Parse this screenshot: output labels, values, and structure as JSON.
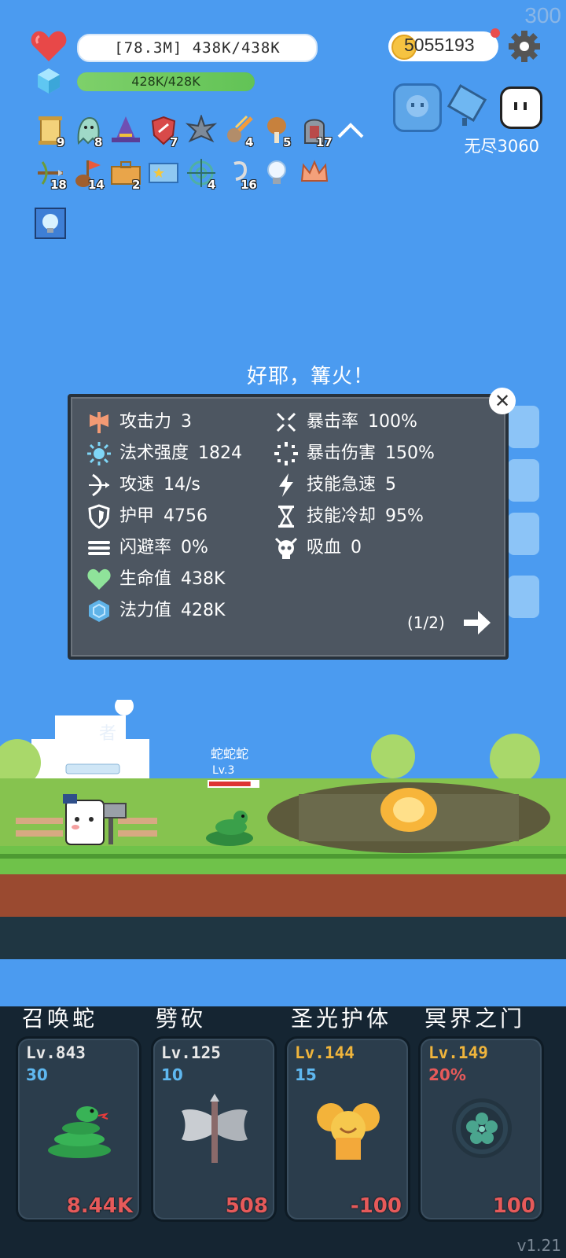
{
  "fps": "300",
  "hud": {
    "hp_text": "[78.3M] 438K/438K",
    "mp_text": "428K/428K",
    "mp_fraction": 1.0,
    "gold": "5055193",
    "endless_label": "无尽3060"
  },
  "inventory": {
    "row1": [
      {
        "icon": "scroll-icon",
        "count": "9"
      },
      {
        "icon": "ghost-icon",
        "count": "8"
      },
      {
        "icon": "wizard-hat-icon",
        "count": ""
      },
      {
        "icon": "shield-icon",
        "count": "7"
      },
      {
        "icon": "spiked-ball-icon",
        "count": ""
      },
      {
        "icon": "meteor-icon",
        "count": "4"
      },
      {
        "icon": "drumstick-icon",
        "count": "5"
      },
      {
        "icon": "tombstone-icon",
        "count": "17"
      }
    ],
    "row2": [
      {
        "icon": "crossbow-icon",
        "count": "18"
      },
      {
        "icon": "flag-icon",
        "count": "14"
      },
      {
        "icon": "briefcase-icon",
        "count": "2"
      },
      {
        "icon": "card-icon",
        "count": ""
      },
      {
        "icon": "target-icon",
        "count": "4"
      },
      {
        "icon": "hook-icon",
        "count": "16"
      },
      {
        "icon": "bulb-icon",
        "count": ""
      },
      {
        "icon": "crown-icon",
        "count": ""
      }
    ]
  },
  "stats_panel": {
    "title": "好耶，篝火！",
    "left": [
      {
        "icon": "axe-icon",
        "label": "攻击力",
        "value": "3"
      },
      {
        "icon": "sun-icon",
        "label": "法术强度",
        "value": "1824"
      },
      {
        "icon": "bow-icon",
        "label": "攻速",
        "value": "14/s"
      },
      {
        "icon": "shield-icon",
        "label": "护甲",
        "value": "4756"
      },
      {
        "icon": "dodge-icon",
        "label": "闪避率",
        "value": "0%"
      },
      {
        "icon": "heart-icon",
        "label": "生命值",
        "value": "438K"
      },
      {
        "icon": "mana-icon",
        "label": "法力值",
        "value": "428K"
      }
    ],
    "right": [
      {
        "icon": "crit-icon",
        "label": "暴击率",
        "value": "100%"
      },
      {
        "icon": "crit-damage-icon",
        "label": "暴击伤害",
        "value": "150%"
      },
      {
        "icon": "lightning-icon",
        "label": "技能急速",
        "value": "5"
      },
      {
        "icon": "hourglass-icon",
        "label": "技能冷却",
        "value": "95%"
      },
      {
        "icon": "skull-icon",
        "label": "吸血",
        "value": "0"
      }
    ],
    "page": "(1/2)"
  },
  "scene": {
    "hero_label": "者",
    "enemy_name": "蛇蛇蛇",
    "enemy_level": "Lv.3",
    "enemy_hp_fraction": 0.85
  },
  "skills": [
    {
      "name": "召唤蛇",
      "level": "Lv.843",
      "cost": "30",
      "cost_color": "#5fb8f0",
      "value": "8.44K",
      "level_color": "#e8e8e8",
      "icon": "snake-icon"
    },
    {
      "name": "劈砍",
      "level": "Lv.125",
      "cost": "10",
      "cost_color": "#5fb8f0",
      "value": "508",
      "level_color": "#e8e8e8",
      "icon": "battle-axe-icon"
    },
    {
      "name": "圣光护体",
      "level": "Lv.144",
      "cost": "15",
      "cost_color": "#5fb8f0",
      "value": "-100",
      "level_color": "#f0b53c",
      "icon": "angel-icon"
    },
    {
      "name": "冥界之门",
      "level": "Lv.149",
      "cost": "20%",
      "cost_color": "#e65a5a",
      "value": "100",
      "level_color": "#f0b53c",
      "icon": "portal-icon"
    }
  ],
  "version": "v1.21"
}
